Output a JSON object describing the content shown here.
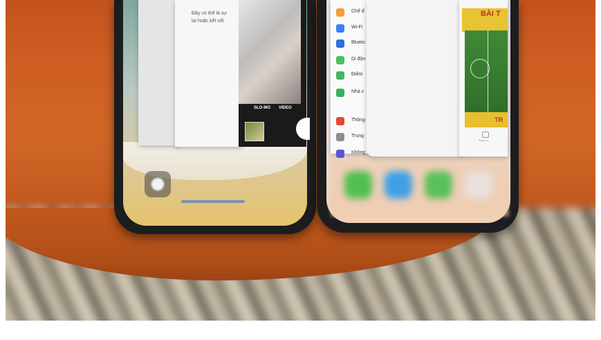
{
  "left_phone": {
    "note_card_lines": [
      "Đây có thể là sự",
      "lại hoặc kết nối"
    ],
    "camera_modes": [
      "SLO-MO",
      "VIDEO"
    ]
  },
  "right_phone": {
    "settings_items": [
      {
        "label": "Chế đ",
        "color": "#f2a13a"
      },
      {
        "label": "Wi-Fi",
        "color": "#3b82f6"
      },
      {
        "label": "Blueto",
        "color": "#2f6fe0"
      },
      {
        "label": "Di độn",
        "color": "#4cc25b"
      },
      {
        "label": "Điểm",
        "color": "#42b860"
      },
      {
        "label": "Nhà c",
        "color": "#35b55a"
      },
      {
        "label": "Thông",
        "color": "#e8483a"
      },
      {
        "label": "Trung",
        "color": "#8e8e93"
      },
      {
        "label": "Không",
        "color": "#5856d6"
      }
    ],
    "game_card": {
      "banner_title": "BÀI T",
      "footer_label": "TR",
      "tab_label": "Bảng ch"
    },
    "dock_icon_colors": [
      "#4fbf4f",
      "#3fa0e6",
      "#5ac05a",
      "#e9e0de"
    ]
  }
}
